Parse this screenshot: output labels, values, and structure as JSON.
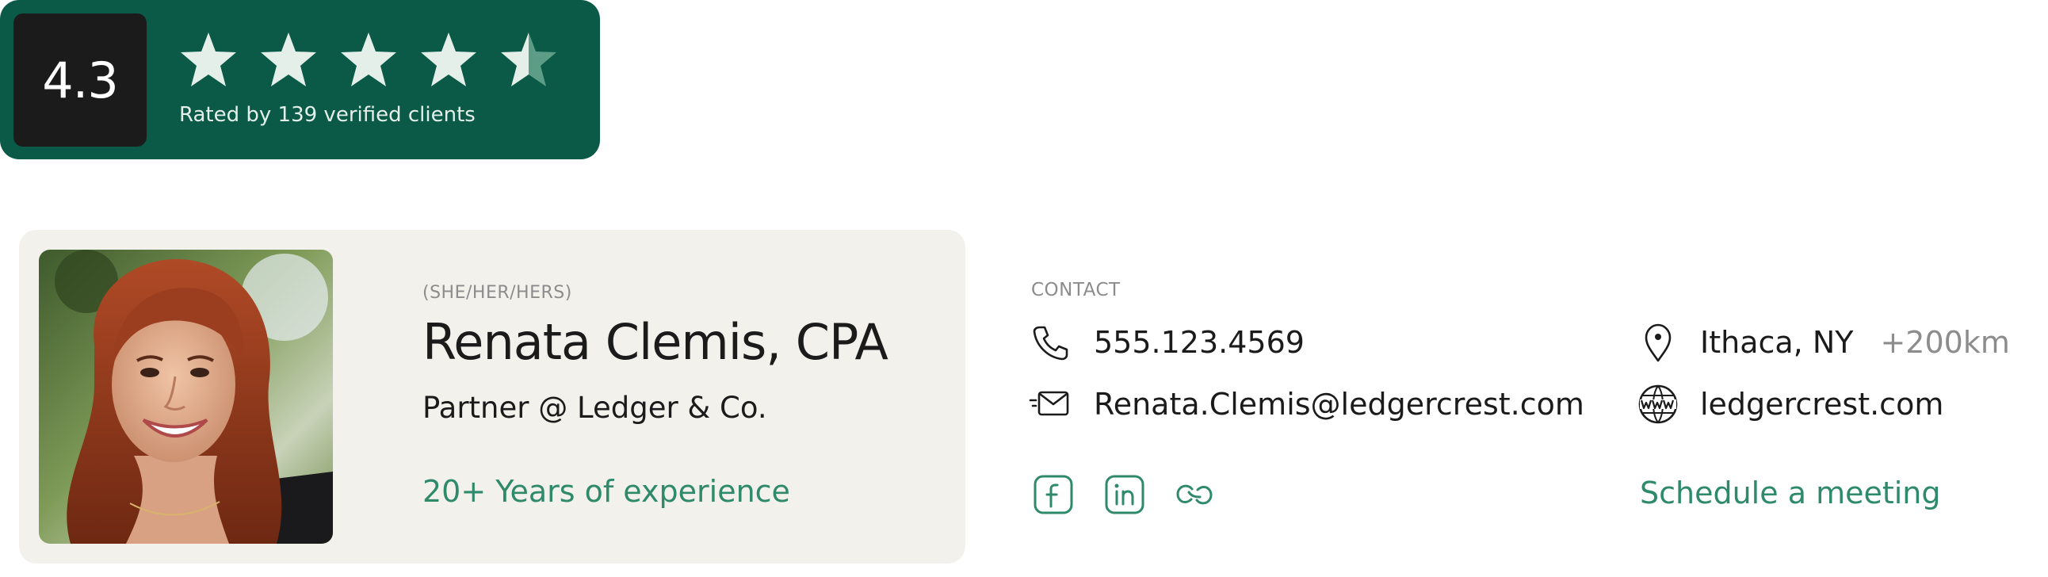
{
  "rating": {
    "score": "4.3",
    "stars_filled": 4.5,
    "stars_total": 5,
    "rated_by": "Rated by 139 verified clients"
  },
  "profile": {
    "pronouns": "(SHE/HER/HERS)",
    "name": "Renata Clemis, CPA",
    "title": "Partner @ Ledger & Co.",
    "experience": "20+ Years of experience"
  },
  "contact": {
    "heading": "CONTACT",
    "phone": "555.123.4569",
    "email": "Renata.Clemis@ledgercrest.com",
    "location": "Ithaca, NY",
    "radius": "+200km",
    "website": "ledgercrest.com",
    "schedule_label": "Schedule a meeting",
    "social": [
      {
        "icon": "facebook-icon"
      },
      {
        "icon": "linkedin-icon"
      },
      {
        "icon": "link-icon"
      }
    ]
  },
  "colors": {
    "badge_bg": "#0b5a48",
    "score_bg": "#1b1b1b",
    "accent_green": "#2e8a6a",
    "card_bg": "#f2f1ec",
    "star_fill": "#e4efea",
    "muted_text": "#8c8c8c"
  }
}
